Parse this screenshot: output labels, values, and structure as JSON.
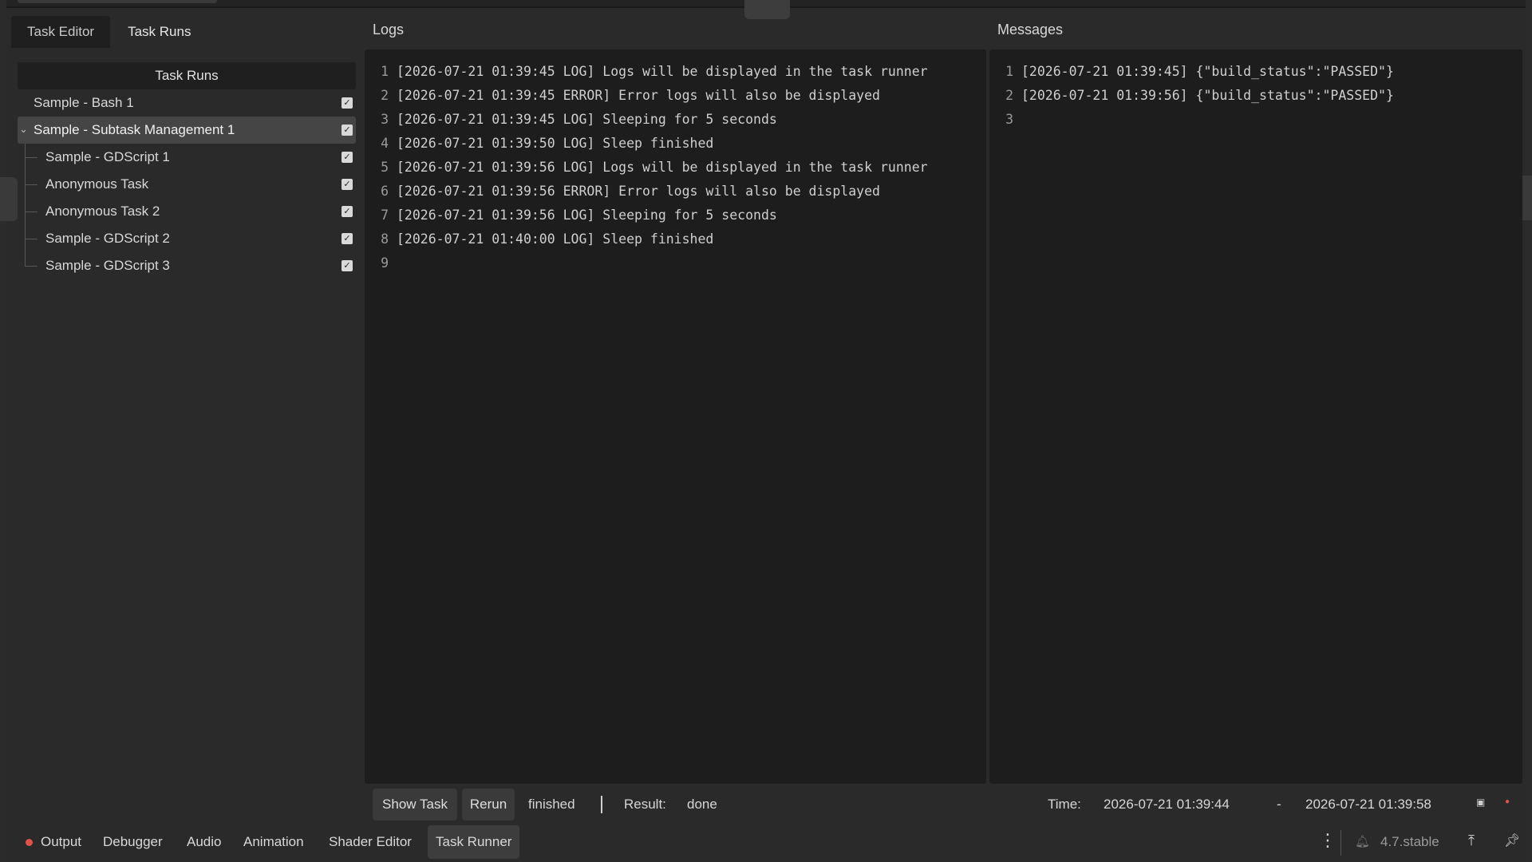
{
  "tabs": [
    "Task Editor",
    "Task Runs"
  ],
  "tree": {
    "header": "Task Runs",
    "items": [
      {
        "label": "Sample - Bash 1",
        "level": 0,
        "checked": true
      },
      {
        "label": "Sample - Subtask Management 1",
        "level": 0,
        "checked": true,
        "selected": true,
        "expanded": true
      },
      {
        "label": "Sample - GDScript 1",
        "level": 1,
        "checked": true
      },
      {
        "label": "Anonymous Task",
        "level": 1,
        "checked": true
      },
      {
        "label": "Anonymous Task 2",
        "level": 1,
        "checked": true
      },
      {
        "label": "Sample - GDScript 2",
        "level": 1,
        "checked": true
      },
      {
        "label": "Sample - GDScript 3",
        "level": 1,
        "checked": true
      }
    ]
  },
  "logs": {
    "title": "Logs",
    "lines": [
      {
        "n": "1",
        "text": "[2026-07-21 01:39:45 LOG] Logs will be displayed in the task runner"
      },
      {
        "n": "2",
        "text": "[2026-07-21 01:39:45 ERROR] Error logs will also be displayed"
      },
      {
        "n": "3",
        "text": "[2026-07-21 01:39:45 LOG] Sleeping for 5 seconds"
      },
      {
        "n": "4",
        "text": "[2026-07-21 01:39:50 LOG] Sleep finished"
      },
      {
        "n": "5",
        "text": "[2026-07-21 01:39:56 LOG] Logs will be displayed in the task runner"
      },
      {
        "n": "6",
        "text": "[2026-07-21 01:39:56 ERROR] Error logs will also be displayed"
      },
      {
        "n": "7",
        "text": "[2026-07-21 01:39:56 LOG] Sleeping for 5 seconds"
      },
      {
        "n": "8",
        "text": "[2026-07-21 01:40:00 LOG] Sleep finished"
      },
      {
        "n": "9",
        "text": ""
      }
    ]
  },
  "messages": {
    "title": "Messages",
    "lines": [
      {
        "n": "1",
        "text": "[2026-07-21 01:39:45] {\"build_status\":\"PASSED\"}"
      },
      {
        "n": "2",
        "text": "[2026-07-21 01:39:56] {\"build_status\":\"PASSED\"}"
      },
      {
        "n": "3",
        "text": ""
      }
    ]
  },
  "status": {
    "show_task": "Show Task",
    "rerun": "Rerun",
    "state": "finished",
    "result_label": "Result:",
    "result_value": "done",
    "time_label": "Time:",
    "time_start": "2026-07-21 01:39:44",
    "time_dash": "-",
    "time_end": "2026-07-21 01:39:58"
  },
  "bottom_tabs": [
    {
      "label": "Output",
      "dot": true
    },
    {
      "label": "Debugger"
    },
    {
      "label": "Audio"
    },
    {
      "label": "Animation"
    },
    {
      "label": "Shader Editor"
    },
    {
      "label": "Task Runner",
      "active": true
    }
  ],
  "version": "4.7.stable",
  "colors": {
    "error_dot": "#e2524b",
    "panel_bg": "#1d1d1d",
    "selected_row": "#454545"
  }
}
